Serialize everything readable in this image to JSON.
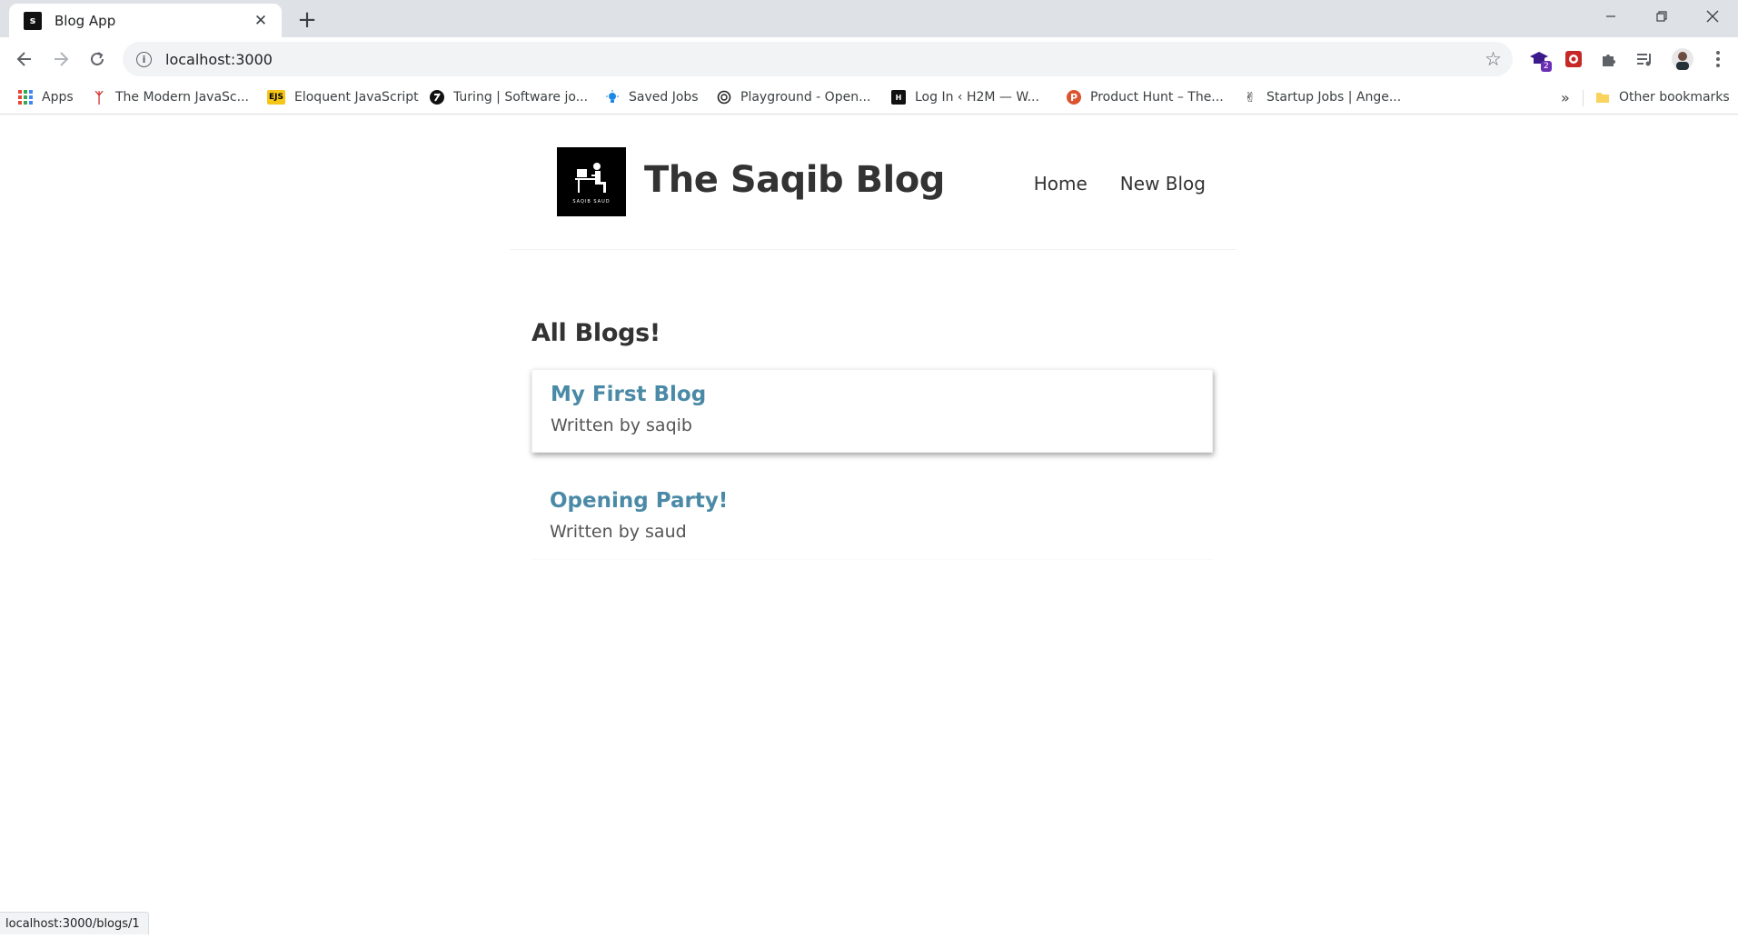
{
  "browser": {
    "tab": {
      "title": "Blog App",
      "favicon_text": "s"
    },
    "url": "localhost:3000",
    "bookmarks": [
      {
        "label": "Apps",
        "icon": "apps-grid-icon"
      },
      {
        "label": "The Modern JavaSc...",
        "icon": "modern-js-icon"
      },
      {
        "label": "Eloquent JavaScript",
        "icon": "ejs-icon",
        "icon_text": "EJS"
      },
      {
        "label": "Turing | Software jo...",
        "icon": "turing-icon"
      },
      {
        "label": "Saved Jobs",
        "icon": "bulb-icon"
      },
      {
        "label": "Playground - Open...",
        "icon": "openai-icon"
      },
      {
        "label": "Log In ‹ H2M — W...",
        "icon": "h2m-icon"
      },
      {
        "label": "Product Hunt – The...",
        "icon": "product-hunt-icon",
        "icon_text": "P"
      },
      {
        "label": "Startup Jobs | Ange...",
        "icon": "angellist-icon"
      }
    ],
    "bookmarks_overflow": "»",
    "other_bookmarks": "Other bookmarks",
    "extension_badge": "2",
    "status_url": "localhost:3000/blogs/1"
  },
  "site": {
    "logo_caption": "SAQIB SAUD",
    "brand": "The Saqib Blog",
    "nav": [
      {
        "label": "Home"
      },
      {
        "label": "New Blog"
      }
    ]
  },
  "main": {
    "heading": "All Blogs!",
    "blogs": [
      {
        "title": "My First Blog",
        "author": "Written by saqib"
      },
      {
        "title": "Opening Party!",
        "author": "Written by saud"
      }
    ]
  }
}
